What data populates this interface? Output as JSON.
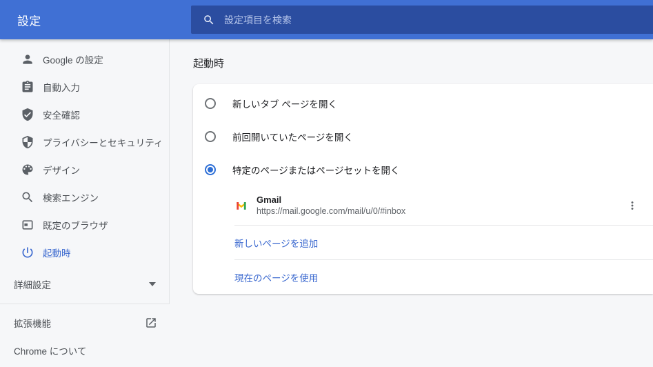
{
  "colors": {
    "header_bg": "#4070d4",
    "search_bg": "#2b4da0",
    "page_bg": "#f6f7f9",
    "accent": "#3a68cf",
    "radio": "#2e6fd6"
  },
  "header": {
    "title": "設定",
    "search": {
      "placeholder": "設定項目を検索"
    }
  },
  "sidebar": {
    "items": [
      {
        "label": "Google の設定",
        "icon": "person"
      },
      {
        "label": "自動入力",
        "icon": "clipboard"
      },
      {
        "label": "安全確認",
        "icon": "shield-check"
      },
      {
        "label": "プライバシーとセキュリティ",
        "icon": "shield-half"
      },
      {
        "label": "デザイン",
        "icon": "palette"
      },
      {
        "label": "検索エンジン",
        "icon": "search"
      },
      {
        "label": "既定のブラウザ",
        "icon": "browser-window"
      },
      {
        "label": "起動時",
        "icon": "power",
        "selected": true
      }
    ],
    "advanced": {
      "label": "詳細設定"
    },
    "footer": [
      {
        "label": "拡張機能",
        "icon": "open-in-new"
      },
      {
        "label": "Chrome について"
      }
    ]
  },
  "main": {
    "section_title": "起動時",
    "options": [
      {
        "label": "新しいタブ ページを開く",
        "selected": false
      },
      {
        "label": "前回開いていたページを開く",
        "selected": false
      },
      {
        "label": "特定のページまたはページセットを開く",
        "selected": true
      }
    ],
    "startup_page": {
      "title": "Gmail",
      "url": "https://mail.google.com/mail/u/0/#inbox"
    },
    "actions": [
      {
        "label": "新しいページを追加"
      },
      {
        "label": "現在のページを使用"
      }
    ]
  }
}
